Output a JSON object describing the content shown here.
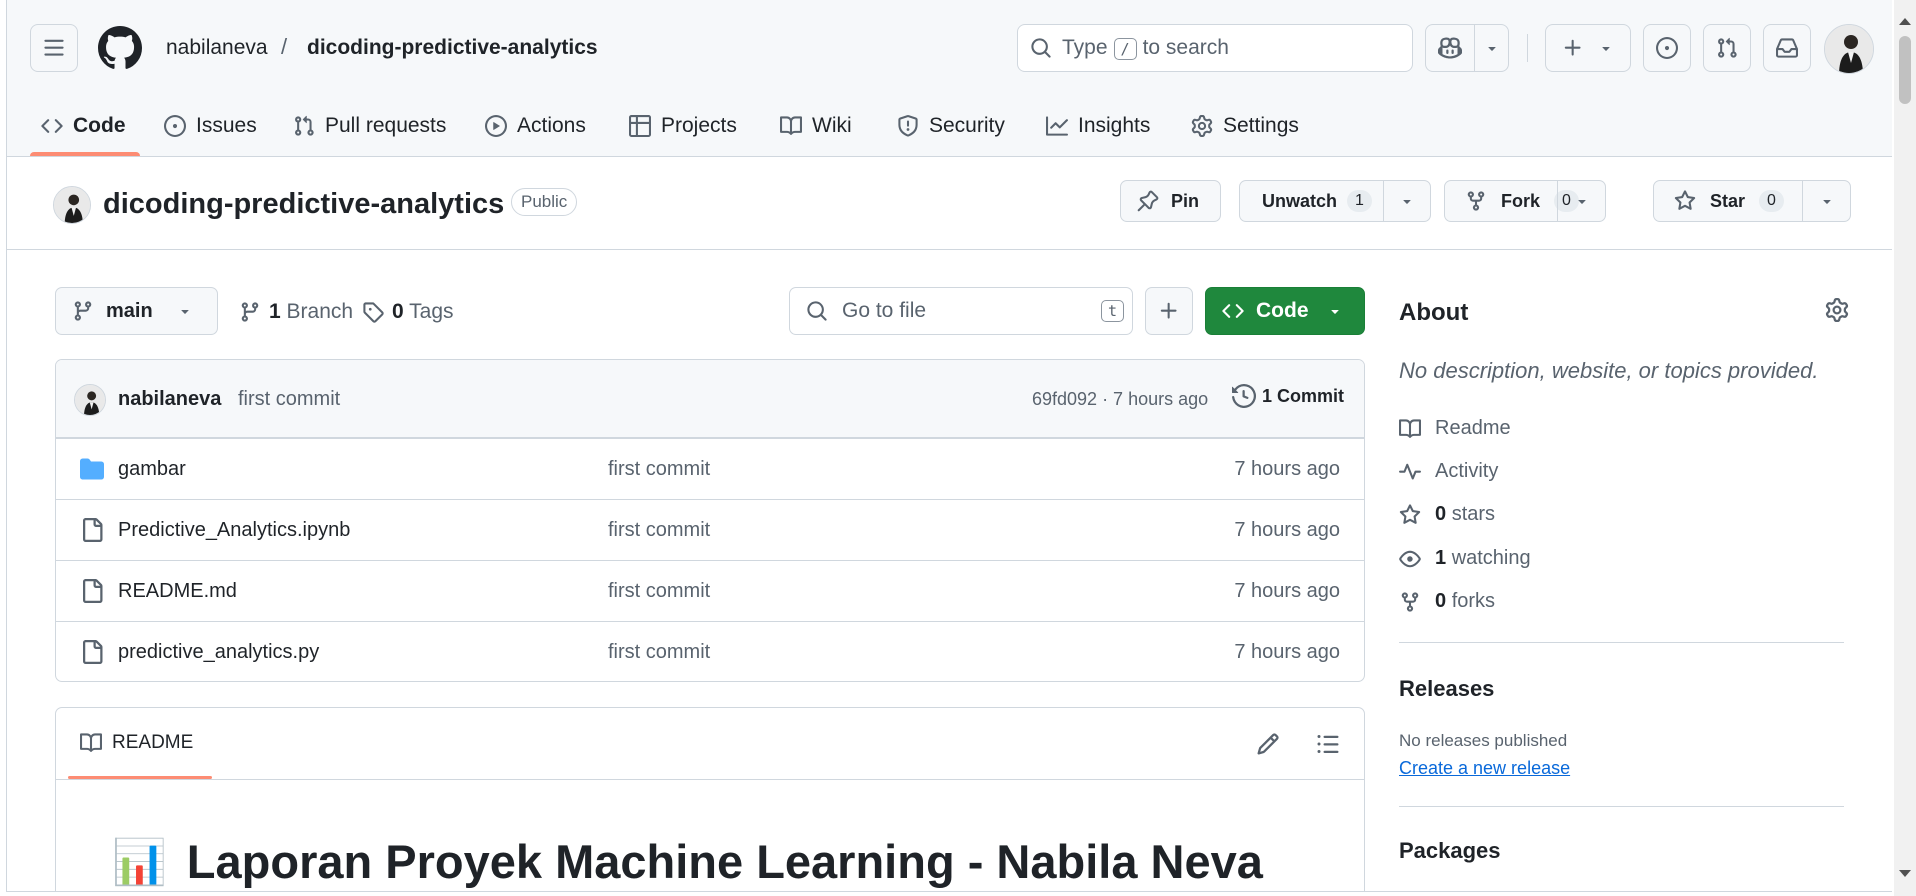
{
  "header": {
    "owner": "nabilaneva",
    "separator": "/",
    "repo": "dicoding-predictive-analytics",
    "search": {
      "before": "Type",
      "key": "/",
      "after": "to search"
    }
  },
  "tabs": [
    {
      "label": "Code",
      "icon": "code-icon",
      "active": true
    },
    {
      "label": "Issues",
      "icon": "issue-icon"
    },
    {
      "label": "Pull requests",
      "icon": "pull-request-icon"
    },
    {
      "label": "Actions",
      "icon": "play-icon"
    },
    {
      "label": "Projects",
      "icon": "table-icon"
    },
    {
      "label": "Wiki",
      "icon": "book-icon"
    },
    {
      "label": "Security",
      "icon": "shield-icon"
    },
    {
      "label": "Insights",
      "icon": "graph-icon"
    },
    {
      "label": "Settings",
      "icon": "gear-icon"
    }
  ],
  "repo_bar": {
    "name": "dicoding-predictive-analytics",
    "visibility": "Public",
    "pin_label": "Pin",
    "watch_label": "Unwatch",
    "watch_count": "1",
    "fork_label": "Fork",
    "fork_count": "0",
    "star_label": "Star",
    "star_count": "0"
  },
  "toolbar": {
    "branch": "main",
    "branch_count": "1",
    "branch_label": "Branch",
    "tag_count": "0",
    "tag_label": "Tags",
    "goto_placeholder": "Go to file",
    "goto_key": "t",
    "code_label": "Code"
  },
  "latest_commit": {
    "author": "nabilaneva",
    "message": "first commit",
    "sha_time": "69fd092 · 7 hours ago",
    "count_label": "1 Commit"
  },
  "files": [
    {
      "name": "gambar",
      "type": "folder",
      "message": "first commit",
      "time": "7 hours ago"
    },
    {
      "name": "Predictive_Analytics.ipynb",
      "type": "file",
      "message": "first commit",
      "time": "7 hours ago"
    },
    {
      "name": "README.md",
      "type": "file",
      "message": "first commit",
      "time": "7 hours ago"
    },
    {
      "name": "predictive_analytics.py",
      "type": "file",
      "message": "first commit",
      "time": "7 hours ago"
    }
  ],
  "readme": {
    "tab_label": "README",
    "emoji": "📊",
    "heading": "Laporan Proyek Machine Learning - Nabila Neva"
  },
  "about": {
    "title": "About",
    "description": "No description, website, or topics provided.",
    "readme_label": "Readme",
    "activity_label": "Activity",
    "stars_count": "0",
    "stars_label": "stars",
    "watching_count": "1",
    "watching_label": "watching",
    "forks_count": "0",
    "forks_label": "forks"
  },
  "releases": {
    "title": "Releases",
    "note": "No releases published",
    "link": "Create a new release"
  },
  "packages": {
    "title": "Packages"
  },
  "colors": {
    "accent_underline": "#fd8c73",
    "primary_green": "#1f883d",
    "link_blue": "#0969da",
    "folder_blue": "#54aeff"
  }
}
